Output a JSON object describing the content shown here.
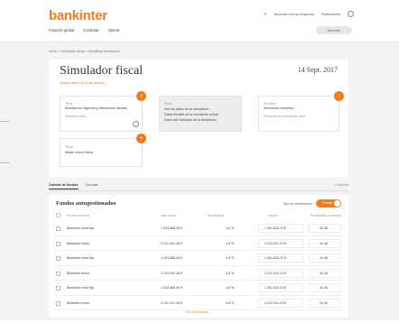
{
  "header": {
    "logo": "bankinter",
    "top_links": [
      "Acceder con su empresa",
      "Particulares"
    ],
    "nav": [
      "Posición global",
      "Contratar",
      "Operar"
    ],
    "access_button": "Acceder"
  },
  "breadcrumb": "Inicio > Simulador fiscal > Modificar simulación",
  "main": {
    "title": "Simulador fiscal",
    "date": "14 Sept. 2017",
    "sub_link": "Ajustar datos de la simulación",
    "cards": [
      {
        "label": "Titular",
        "text": "Modifica los ingresos y retenciones fiscales",
        "text2": "Simulación fiscal"
      },
      {
        "label": "Datos",
        "text": "Vea los datos de su simulación",
        "text2": "Datos fiscales de la simulación actual",
        "text3": "Datos del resultado de la simulación"
      },
      {
        "label": "Resultado",
        "text": "Simulación completa",
        "text2": "Resultado de la simulación fiscal"
      },
      {
        "label": "Titular",
        "text": "Añadir nuevo titular"
      }
    ]
  },
  "tabs": [
    "Cartera de fondos",
    "Cuentas"
  ],
  "search_label": "Buscar",
  "table": {
    "title": "Fondos autogestionados",
    "view_label": "Tipo de visualización",
    "toggle_label": "Fondos",
    "headers": [
      "Nombre del fondo",
      "Valor actual",
      "Rentabilidad",
      "Importe",
      "Rentabilidad acumulada"
    ],
    "rows": [
      {
        "name": "Bankinter renta fija",
        "value": "1.543.888,45 €",
        "pct": "4,8 %",
        "amount": "1.361.832,23 €",
        "yield": "42,38"
      },
      {
        "name": "Bankinter bolsa",
        "value": "3.131.941,46 €",
        "pct": "4,8 %",
        "amount": "3.212.541,23 €",
        "yield": "42,38"
      },
      {
        "name": "Bankinter renta fija",
        "value": "1.543.888,45 €",
        "pct": "4,8 %",
        "amount": "1.361.832,23 €",
        "yield": "42,38"
      },
      {
        "name": "Bankinter bolsa",
        "value": "3.131.941,46 €",
        "pct": "4,8 %",
        "amount": "3.212.541,23 €",
        "yield": "42,38"
      },
      {
        "name": "Bankinter renta fija",
        "value": "1.543.888,45 €",
        "pct": "4,8 %",
        "amount": "1.361.832,23 €",
        "yield": "42,38"
      },
      {
        "name": "Bankinter bolsa",
        "value": "3.131.941,46 €",
        "pct": "4,8 %",
        "amount": "3.212.541,23 €",
        "yield": "42,38"
      }
    ],
    "view_more": "Ver más fondos"
  },
  "colors": {
    "accent": "#f07d1a",
    "background": "#f3f3f3"
  }
}
